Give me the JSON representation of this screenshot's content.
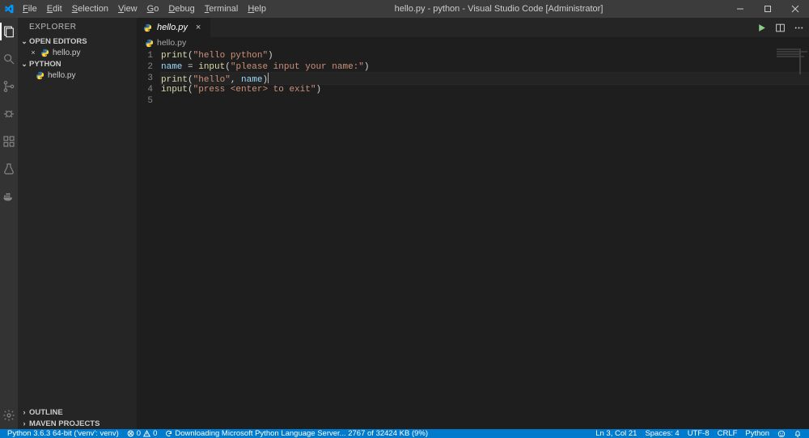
{
  "title": "hello.py - python - Visual Studio Code [Administrator]",
  "menu": [
    "File",
    "Edit",
    "Selection",
    "View",
    "Go",
    "Debug",
    "Terminal",
    "Help"
  ],
  "explorer": {
    "header": "EXPLORER",
    "open_editors_label": "OPEN EDITORS",
    "open_editors": [
      {
        "name": "hello.py"
      }
    ],
    "workspace_label": "PYTHON",
    "workspace_items": [
      {
        "name": "hello.py"
      }
    ],
    "outline_label": "OUTLINE",
    "maven_label": "MAVEN PROJECTS"
  },
  "tab": {
    "name": "hello.py"
  },
  "breadcrumb": {
    "file": "hello.py"
  },
  "code": {
    "lines": [
      {
        "n": "1",
        "t": [
          [
            "fn",
            "print"
          ],
          [
            "pn",
            "("
          ],
          [
            "str",
            "\"hello python\""
          ],
          [
            "pn",
            ")"
          ]
        ]
      },
      {
        "n": "2",
        "t": [
          [
            "var",
            "name"
          ],
          [
            "op",
            " = "
          ],
          [
            "fn",
            "input"
          ],
          [
            "pn",
            "("
          ],
          [
            "str",
            "\"please input your name:\""
          ],
          [
            "pn",
            ")"
          ]
        ]
      },
      {
        "n": "3",
        "hl": true,
        "t": [
          [
            "fn",
            "print"
          ],
          [
            "pn",
            "("
          ],
          [
            "str",
            "\"hello\""
          ],
          [
            "pn",
            ", "
          ],
          [
            "var",
            "name"
          ],
          [
            "pn",
            ")"
          ]
        ]
      },
      {
        "n": "4",
        "t": [
          [
            "fn",
            "input"
          ],
          [
            "pn",
            "("
          ],
          [
            "str",
            "\"press <enter> to exit\""
          ],
          [
            "pn",
            ")"
          ]
        ]
      },
      {
        "n": "5",
        "t": []
      }
    ]
  },
  "status": {
    "python_env": "Python 3.6.3 64-bit ('venv': venv)",
    "problems": "0",
    "warnings": "0",
    "download_msg": "Downloading Microsoft Python Language Server... 2767 of 32424 KB (9%)",
    "ln_col": "Ln 3, Col 21",
    "spaces": "Spaces: 4",
    "encoding": "UTF-8",
    "eol": "CRLF",
    "language": "Python",
    "feedback": "☺",
    "notifications": "🔔"
  }
}
